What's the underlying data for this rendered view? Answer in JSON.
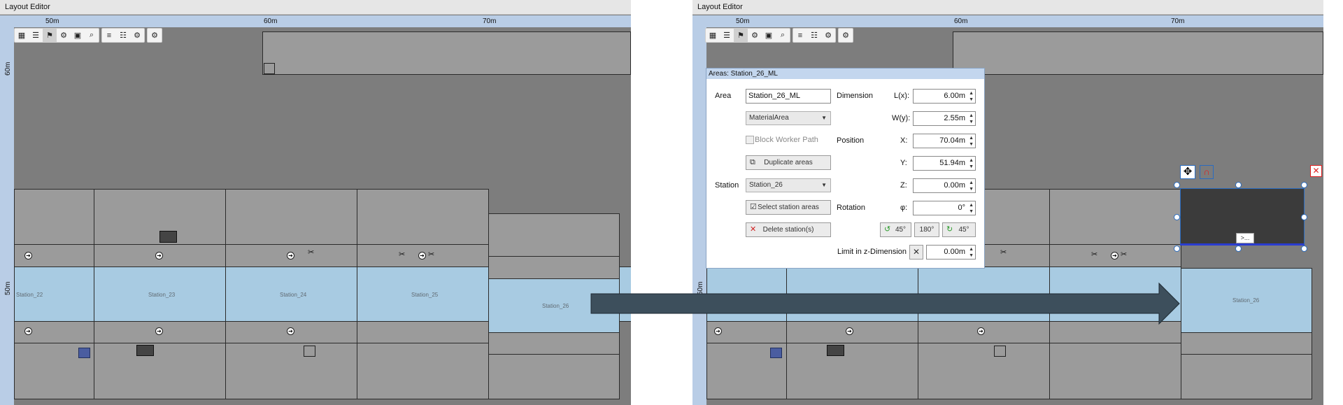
{
  "window_title": "Layout Editor",
  "ruler": {
    "top_labels": [
      "50m",
      "60m",
      "70m"
    ],
    "left_labels": [
      "60m",
      "50m"
    ]
  },
  "toolbar_icons": [
    "grid-icon",
    "rows-icon",
    "area-icon",
    "settings-gear-icon",
    "view-icon",
    "zoom-icon",
    "stack-icon",
    "layers-icon",
    "gear-link-icon",
    "gear-edit-icon"
  ],
  "stations": [
    "Station_22",
    "Station_23",
    "Station_24",
    "Station_25",
    "Station_26"
  ],
  "selection": {
    "more_label": ">..."
  },
  "dialog": {
    "title": "Areas: Station_26_ML",
    "area_label": "Area",
    "area_name": "Station_26_ML",
    "area_type": "MaterialArea",
    "block_worker_path": "Block Worker Path",
    "duplicate_areas": "Duplicate areas",
    "station_label": "Station",
    "station_value": "Station_26",
    "select_station_areas": "Select station areas",
    "delete_stations": "Delete station(s)",
    "dimension_label": "Dimension",
    "lx_label": "L(x):",
    "lx_value": "6.00m",
    "wy_label": "W(y):",
    "wy_value": "2.55m",
    "position_label": "Position",
    "x_label": "X:",
    "x_value": "70.04m",
    "y_label": "Y:",
    "y_value": "51.94m",
    "z_label": "Z:",
    "z_value": "0.00m",
    "rotation_label": "Rotation",
    "phi_label": "φ:",
    "phi_value": "0°",
    "rot_ccw_label": "45°",
    "rot_180_label": "180°",
    "rot_cw_label": "45°",
    "limit_z_label": "Limit in z-Dimension",
    "limit_z_value": "0.00m"
  },
  "colors": {
    "station_blue": "#a8cbe2",
    "floor_gray": "#9b9b9b",
    "background": "#7d7d7d",
    "ruler": "#b9cde6",
    "arrow": "#3d4f5c",
    "selection_blue": "#2a6cc0",
    "close_red": "#e02020"
  }
}
